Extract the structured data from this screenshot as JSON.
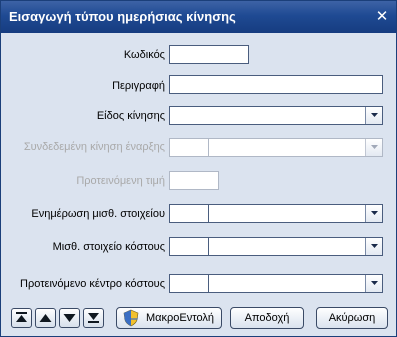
{
  "window": {
    "title": "Εισαγωγή τύπου ημερήσιας κίνησης",
    "close_glyph": "✕"
  },
  "form": {
    "code_label": "Κωδικός",
    "description_label": "Περιγραφή",
    "movement_type_label": "Είδος κίνησης",
    "linked_start_label": "Συνδεδεμένη κίνηση έναρξης",
    "suggested_value_label": "Προτεινόμενη τιμή",
    "update_payroll_label": "Ενημέρωση μισθ. στοιχείου",
    "payroll_cost_label": "Μισθ. στοιχείο κόστους",
    "suggested_cost_center_label": "Προτεινόμενο κέντρο κόστους"
  },
  "buttons": {
    "macro_label": "ΜακροΕντολή",
    "accept_label": "Αποδοχή",
    "cancel_label": "Ακύρωση"
  },
  "icons": {
    "first": "nav-first-icon",
    "previous": "nav-previous-icon",
    "next": "nav-next-icon",
    "last": "nav-last-icon",
    "macro": "shield-icon",
    "dropdown": "chevron-down-icon"
  },
  "colors": {
    "titlebar": "#1f4a93",
    "body": "#dbe3ef",
    "disabled_text": "#a9a9a9"
  }
}
